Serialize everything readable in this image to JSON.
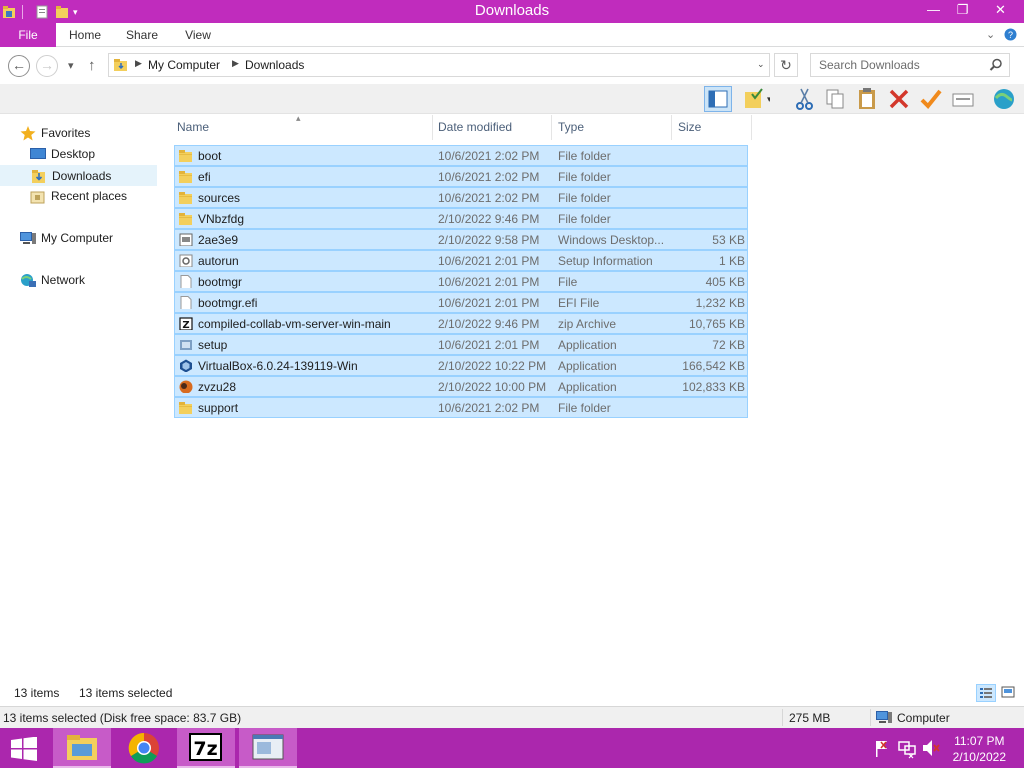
{
  "window": {
    "title": "Downloads",
    "controls": {
      "minimize": "—",
      "maximize": "❐",
      "close": "✕"
    }
  },
  "ribbon": {
    "tabs": [
      "File",
      "Home",
      "Share",
      "View"
    ],
    "collapse_icon": "chevron-down-icon",
    "help_icon": "help-icon"
  },
  "address": {
    "back_icon": "back-arrow-icon",
    "forward_icon": "forward-arrow-icon",
    "recent_icon": "chevron-down-icon",
    "up_icon": "up-arrow-icon",
    "crumbs": [
      "My Computer",
      "Downloads"
    ],
    "refresh_icon": "refresh-icon",
    "search_placeholder": "Search Downloads"
  },
  "nav": {
    "favorites": "Favorites",
    "desktop": "Desktop",
    "downloads": "Downloads",
    "recent_places": "Recent places",
    "my_computer": "My Computer",
    "network": "Network"
  },
  "columns": {
    "name": "Name",
    "date": "Date modified",
    "type": "Type",
    "size": "Size"
  },
  "files": [
    {
      "name": "boot",
      "date": "10/6/2021 2:02 PM",
      "type": "File folder",
      "size": "",
      "icon": "folder-icon"
    },
    {
      "name": "efi",
      "date": "10/6/2021 2:02 PM",
      "type": "File folder",
      "size": "",
      "icon": "folder-icon"
    },
    {
      "name": "sources",
      "date": "10/6/2021 2:02 PM",
      "type": "File folder",
      "size": "",
      "icon": "folder-icon"
    },
    {
      "name": "VNbzfdg",
      "date": "2/10/2022 9:46 PM",
      "type": "File folder",
      "size": "",
      "icon": "folder-icon"
    },
    {
      "name": "2ae3e9",
      "date": "2/10/2022 9:58 PM",
      "type": "Windows Desktop...",
      "size": "53 KB",
      "icon": "desktop-file-icon"
    },
    {
      "name": "autorun",
      "date": "10/6/2021 2:01 PM",
      "type": "Setup Information",
      "size": "1 KB",
      "icon": "setup-info-icon"
    },
    {
      "name": "bootmgr",
      "date": "10/6/2021 2:01 PM",
      "type": "File",
      "size": "405 KB",
      "icon": "file-icon"
    },
    {
      "name": "bootmgr.efi",
      "date": "10/6/2021 2:01 PM",
      "type": "EFI File",
      "size": "1,232 KB",
      "icon": "file-icon"
    },
    {
      "name": "compiled-collab-vm-server-win-main",
      "date": "2/10/2022 9:46 PM",
      "type": "zip Archive",
      "size": "10,765 KB",
      "icon": "zip-icon"
    },
    {
      "name": "setup",
      "date": "10/6/2021 2:01 PM",
      "type": "Application",
      "size": "72 KB",
      "icon": "setup-app-icon"
    },
    {
      "name": "VirtualBox-6.0.24-139119-Win",
      "date": "2/10/2022 10:22 PM",
      "type": "Application",
      "size": "166,542 KB",
      "icon": "virtualbox-icon"
    },
    {
      "name": "zvzu28",
      "date": "2/10/2022 10:00 PM",
      "type": "Application",
      "size": "102,833 KB",
      "icon": "app-icon"
    },
    {
      "name": "support",
      "date": "10/6/2021 2:02 PM",
      "type": "File folder",
      "size": "",
      "icon": "folder-icon"
    }
  ],
  "status": {
    "items": "13 items",
    "selected": "13 items selected",
    "detail": "13 items selected (Disk free space: 83.7 GB)",
    "size": "275 MB",
    "location": "Computer"
  },
  "taskbar": {
    "time": "11:07 PM",
    "date": "2/10/2022",
    "apps": [
      "file-explorer-icon",
      "chrome-icon",
      "7zip-icon",
      "notepad-window-icon"
    ]
  },
  "colors": {
    "accent": "#c02cbd",
    "taskbar": "#ab27ad",
    "selection": "#cce8ff",
    "selection_border": "#99d1ff"
  }
}
